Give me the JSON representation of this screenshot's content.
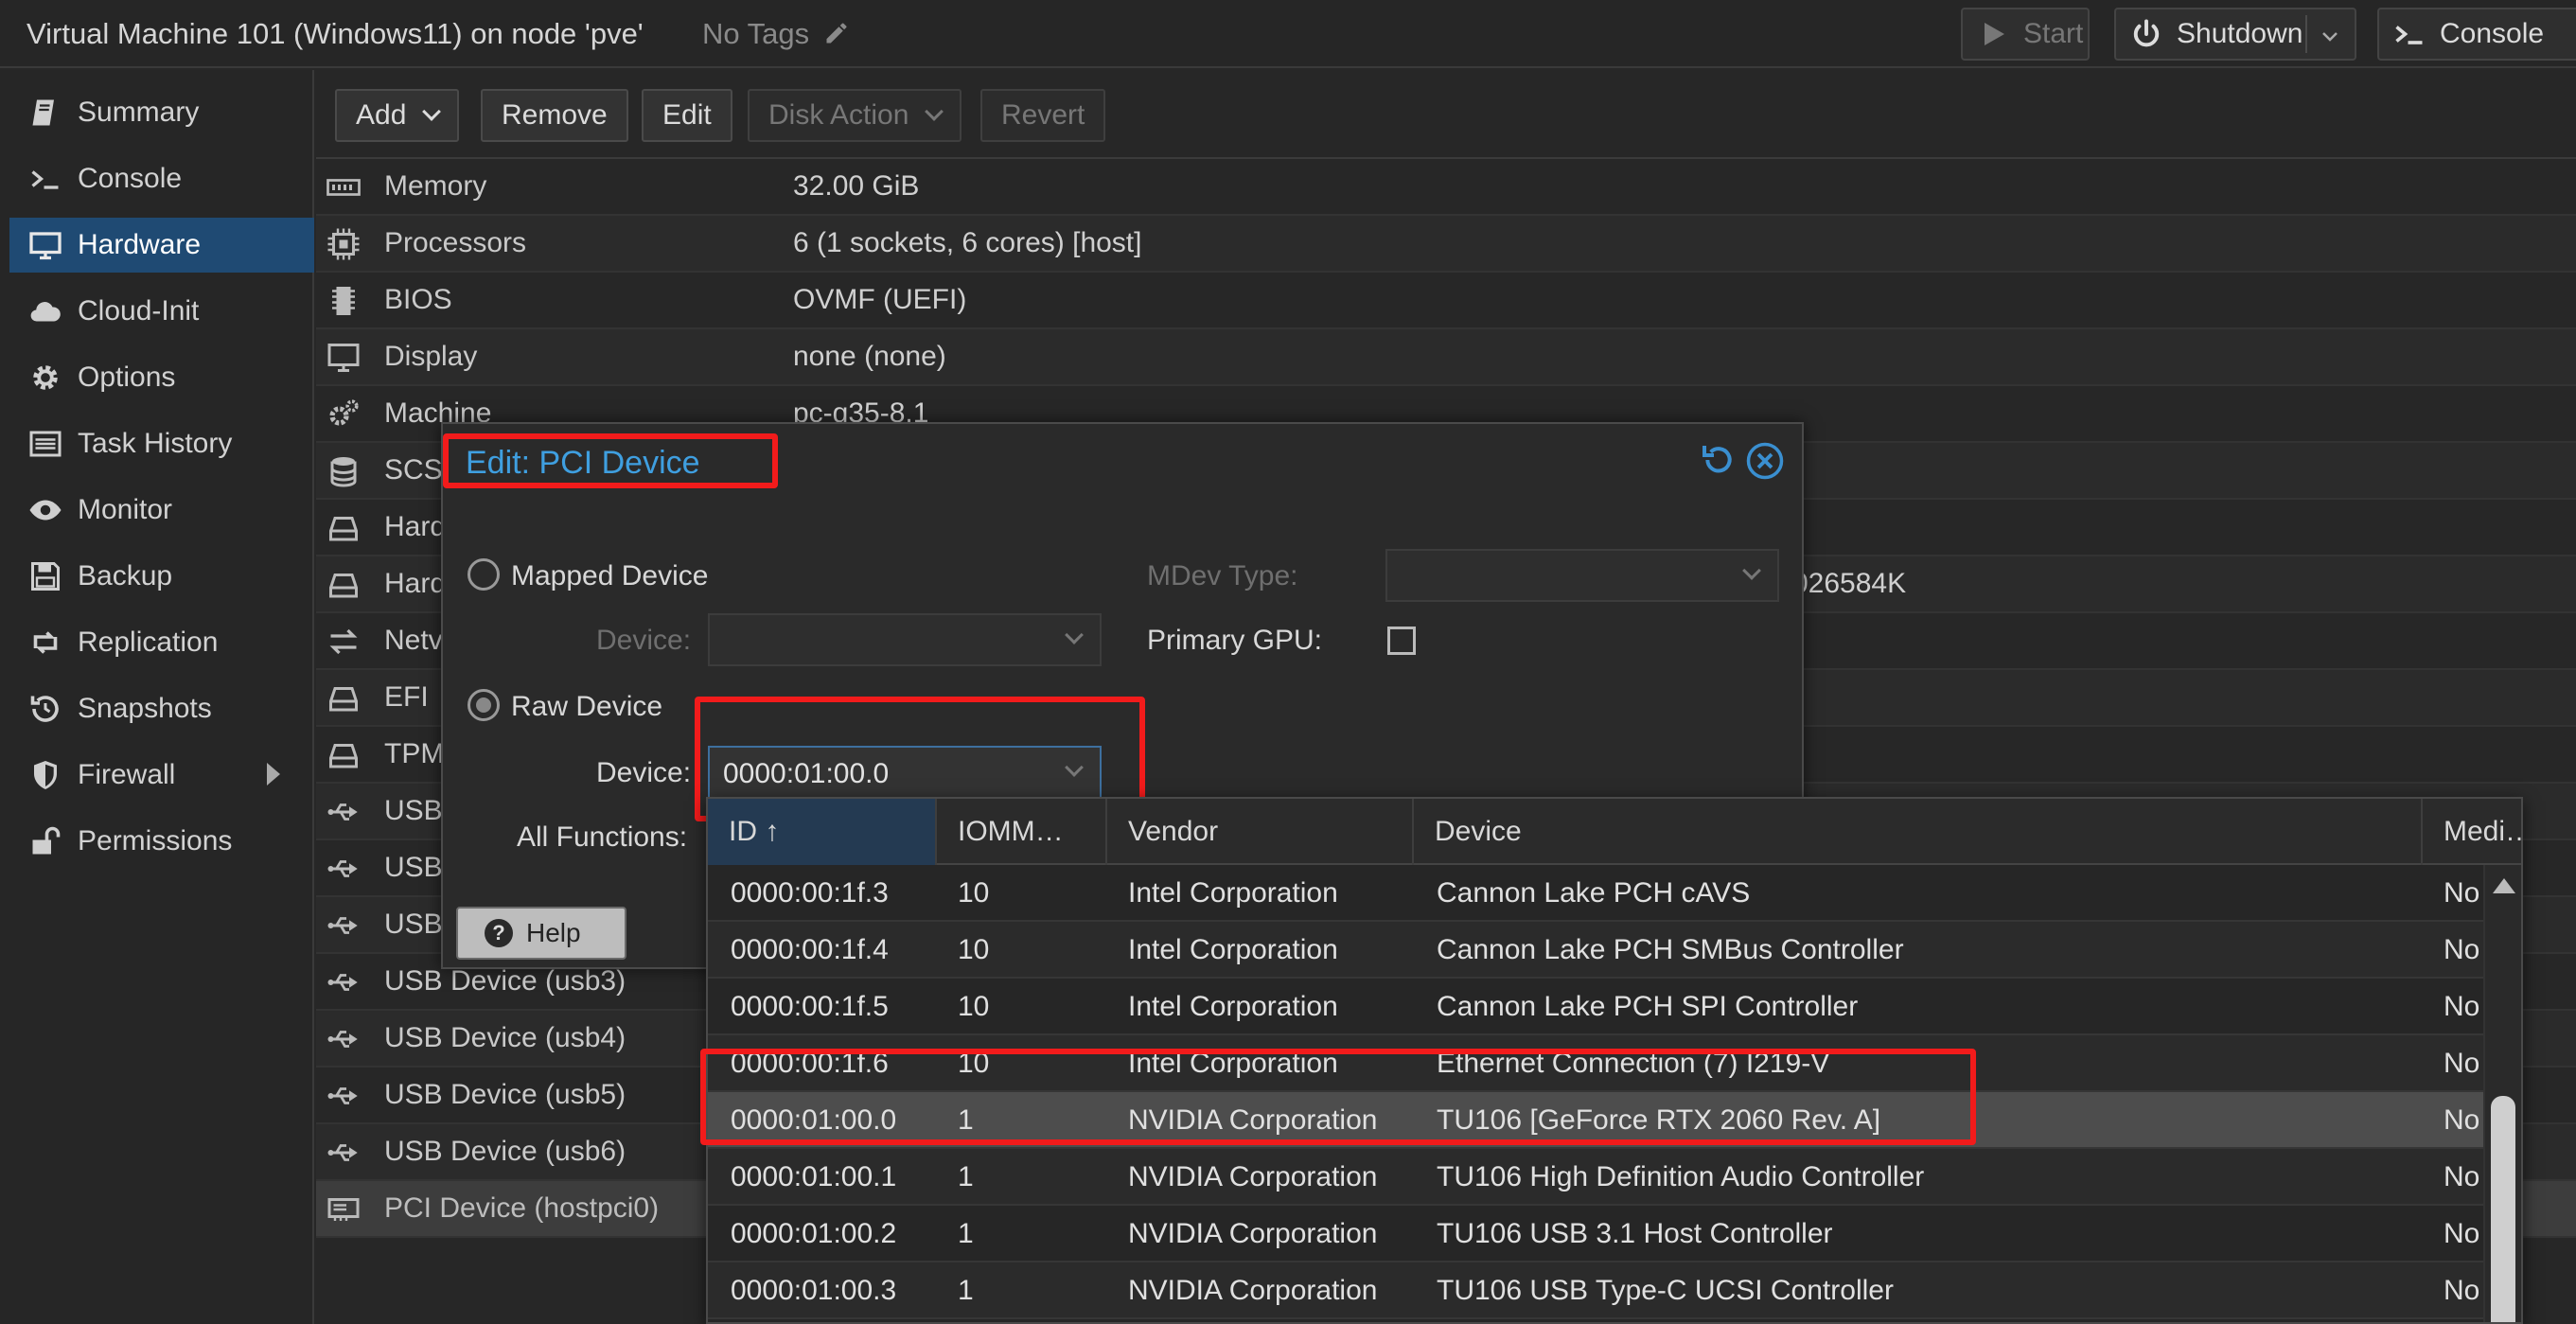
{
  "header": {
    "title": "Virtual Machine 101 (Windows11) on node 'pve'",
    "tags": "No Tags",
    "start_label": "Start",
    "shutdown_label": "Shutdown",
    "console_label": "Console"
  },
  "sidebar": {
    "items": [
      {
        "label": "Summary",
        "icon": "book-icon"
      },
      {
        "label": "Console",
        "icon": "terminal-icon"
      },
      {
        "label": "Hardware",
        "icon": "monitor-icon",
        "active": true
      },
      {
        "label": "Cloud-Init",
        "icon": "cloud-icon"
      },
      {
        "label": "Options",
        "icon": "gear-icon"
      },
      {
        "label": "Task History",
        "icon": "list-icon"
      },
      {
        "label": "Monitor",
        "icon": "eye-icon"
      },
      {
        "label": "Backup",
        "icon": "floppy-icon"
      },
      {
        "label": "Replication",
        "icon": "retweet-icon"
      },
      {
        "label": "Snapshots",
        "icon": "history-icon"
      },
      {
        "label": "Firewall",
        "icon": "shield-icon"
      },
      {
        "label": "Permissions",
        "icon": "unlock-icon"
      }
    ]
  },
  "toolbar": {
    "add_label": "Add",
    "remove_label": "Remove",
    "edit_label": "Edit",
    "disk_action_label": "Disk Action",
    "revert_label": "Revert"
  },
  "hardware": {
    "rows": [
      {
        "key": "Memory",
        "value": "32.00 GiB",
        "icon": "memory-icon"
      },
      {
        "key": "Processors",
        "value": "6 (1 sockets, 6 cores) [host]",
        "icon": "cpu-icon"
      },
      {
        "key": "BIOS",
        "value": "OVMF (UEFI)",
        "icon": "chip-icon"
      },
      {
        "key": "Display",
        "value": "none (none)",
        "icon": "desktop-icon"
      },
      {
        "key": "Machine",
        "value": "pc-q35-8.1",
        "icon": "cogs-icon"
      },
      {
        "key": "SCS",
        "value": "",
        "icon": "database-icon"
      },
      {
        "key": "Hard",
        "value": "",
        "icon": "hdd-icon"
      },
      {
        "key": "Hard",
        "value": "026584K",
        "icon": "hdd-icon"
      },
      {
        "key": "Netv",
        "value": "",
        "icon": "exchange-icon"
      },
      {
        "key": "EFI",
        "value": "",
        "icon": "hdd-icon"
      },
      {
        "key": "TPM",
        "value": "",
        "icon": "hdd-icon"
      },
      {
        "key": "USB",
        "value": "",
        "icon": "usb-icon"
      },
      {
        "key": "USB",
        "value": "",
        "icon": "usb-icon"
      },
      {
        "key": "USB",
        "value": "",
        "icon": "usb-icon"
      },
      {
        "key": "USB Device (usb3)",
        "value": "",
        "icon": "usb-icon"
      },
      {
        "key": "USB Device (usb4)",
        "value": "",
        "icon": "usb-icon"
      },
      {
        "key": "USB Device (usb5)",
        "value": "",
        "icon": "usb-icon"
      },
      {
        "key": "USB Device (usb6)",
        "value": "",
        "icon": "usb-icon"
      },
      {
        "key": "PCI Device (hostpci0)",
        "value": "",
        "icon": "pci-card-icon",
        "selected": true
      }
    ]
  },
  "dialog": {
    "title": "Edit: PCI Device",
    "mapped_device_label": "Mapped Device",
    "device_label": "Device:",
    "raw_device_label": "Raw Device",
    "device_value": "0000:01:00.0",
    "all_functions_label": "All Functions:",
    "mdev_type_label": "MDev Type:",
    "primary_gpu_label": "Primary GPU:",
    "help_label": "Help",
    "raw_selected": true,
    "primary_gpu_checked": false
  },
  "picker": {
    "columns": [
      "ID ↑",
      "IOMM…",
      "Vendor",
      "Device",
      "Medi…"
    ],
    "rows": [
      [
        "0000:00:1f.3",
        "10",
        "Intel Corporation",
        "Cannon Lake PCH cAVS",
        "No"
      ],
      [
        "0000:00:1f.4",
        "10",
        "Intel Corporation",
        "Cannon Lake PCH SMBus Controller",
        "No"
      ],
      [
        "0000:00:1f.5",
        "10",
        "Intel Corporation",
        "Cannon Lake PCH SPI Controller",
        "No"
      ],
      [
        "0000:00:1f.6",
        "10",
        "Intel Corporation",
        "Ethernet Connection (7) I219-V",
        "No"
      ],
      [
        "0000:01:00.0",
        "1",
        "NVIDIA Corporation",
        "TU106 [GeForce RTX 2060 Rev. A]",
        "No"
      ],
      [
        "0000:01:00.1",
        "1",
        "NVIDIA Corporation",
        "TU106 High Definition Audio Controller",
        "No"
      ],
      [
        "0000:01:00.2",
        "1",
        "NVIDIA Corporation",
        "TU106 USB 3.1 Host Controller",
        "No"
      ],
      [
        "0000:01:00.3",
        "1",
        "NVIDIA Corporation",
        "TU106 USB Type-C UCSI Controller",
        "No"
      ]
    ],
    "selected_index": 4
  },
  "colors": {
    "accent": "#3f9fe0",
    "highlight": "#f21b1b",
    "active_nav": "#1f4a73"
  }
}
